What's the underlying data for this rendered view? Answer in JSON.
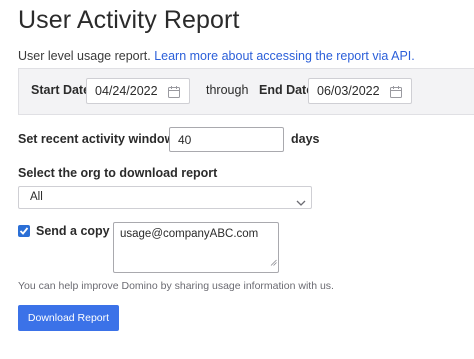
{
  "header": {
    "title": "User Activity Report",
    "subtitle_text": "User level usage report.",
    "subtitle_link": "Learn more about accessing the report via API."
  },
  "date_range": {
    "start_label": "Start Date",
    "start_value": "04/24/2022",
    "through_label": "through",
    "end_label": "End Date",
    "end_value": "06/03/2022",
    "icon": "calendar-icon"
  },
  "activity_window": {
    "label": "Set recent activity window to",
    "value": "40",
    "unit": "days"
  },
  "org_select": {
    "label": "Select the org to download report",
    "selected": "All",
    "icon": "chevron-down-icon"
  },
  "send_copy": {
    "checked": true,
    "label": "Send a copy to",
    "email": "usage@companyABC.com"
  },
  "help_text": "You can help improve Domino by sharing usage information with us.",
  "download_button": "Download Report",
  "colors": {
    "accent": "#3b72e8",
    "link": "#2b5fd9",
    "checkbox": "#2b6fd6",
    "panel_bg": "#f3f3f5"
  }
}
